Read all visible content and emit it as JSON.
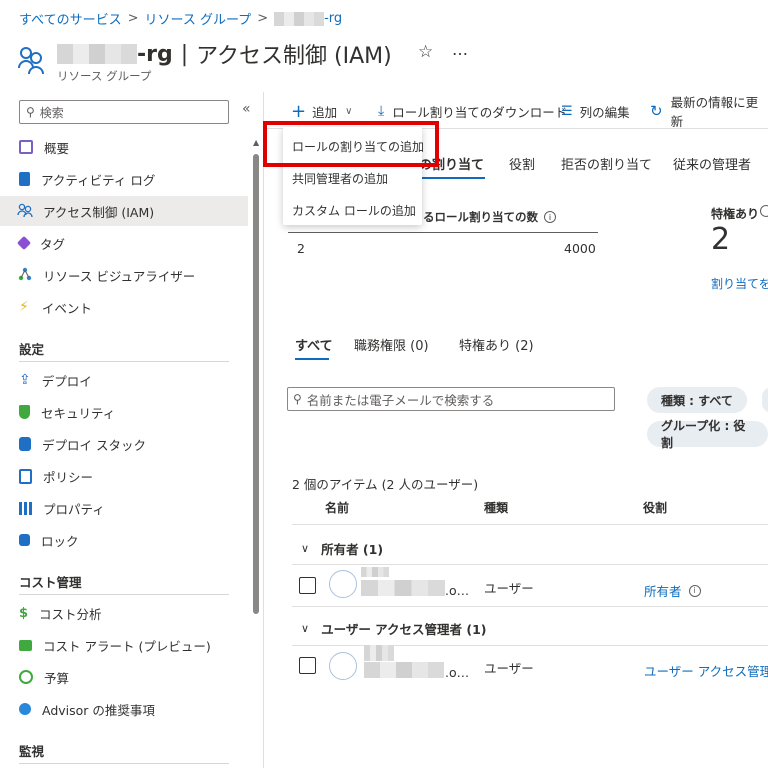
{
  "breadcrumb": {
    "items": [
      "すべてのサービス",
      "リソース グループ"
    ],
    "current_suffix": "-rg",
    "separator": ">"
  },
  "header": {
    "title_suffix": "-rg",
    "title_separator": "|",
    "page_name": "アクセス制御 (IAM)",
    "subtitle": "リソース グループ",
    "star_icon": "star-icon",
    "more_label": "…"
  },
  "sidebar": {
    "search_placeholder": "検索",
    "collapse_label": "«",
    "items": [
      {
        "label": "概要",
        "icon": "overview-icon",
        "color": "#7a5fc4"
      },
      {
        "label": "アクティビティ ログ",
        "icon": "activity-log-icon",
        "color": "#1f6fc4"
      },
      {
        "label": "アクセス制御 (IAM)",
        "icon": "iam-icon",
        "color": "#1f6fc4",
        "active": true
      },
      {
        "label": "タグ",
        "icon": "tag-icon",
        "color": "#8a4fd3"
      },
      {
        "label": "リソース ビジュアライザー",
        "icon": "visualizer-icon",
        "color": "#2b88d8"
      },
      {
        "label": "イベント",
        "icon": "event-icon",
        "color": "#f2b50c"
      }
    ],
    "section_settings": "設定",
    "settings_items": [
      {
        "label": "デプロイ",
        "icon": "deploy-icon",
        "color": "#1f6fc4"
      },
      {
        "label": "セキュリティ",
        "icon": "security-icon",
        "color": "#3fa83f"
      },
      {
        "label": "デプロイ スタック",
        "icon": "deploy-stack-icon",
        "color": "#1f6fc4"
      },
      {
        "label": "ポリシー",
        "icon": "policy-icon",
        "color": "#1f6fc4"
      },
      {
        "label": "プロパティ",
        "icon": "properties-icon",
        "color": "#1f6fc4"
      },
      {
        "label": "ロック",
        "icon": "lock-icon",
        "color": "#1f6fc4"
      }
    ],
    "section_cost": "コスト管理",
    "cost_items": [
      {
        "label": "コスト分析",
        "icon": "cost-analysis-icon",
        "color": "#3fa83f"
      },
      {
        "label": "コスト アラート (プレビュー)",
        "icon": "cost-alert-icon",
        "color": "#3fa83f"
      },
      {
        "label": "予算",
        "icon": "budget-icon",
        "color": "#3fa83f"
      },
      {
        "label": "Advisor の推奨事項",
        "icon": "advisor-icon",
        "color": "#2b88d8"
      }
    ],
    "section_monitor": "監視"
  },
  "toolbar": {
    "add_label": "追加",
    "download_label": "ロール割り当てのダウンロード",
    "edit_columns_label": "列の編集",
    "refresh_label": "最新の情報に更新"
  },
  "dropdown": {
    "items": [
      "ロールの割り当ての追加",
      "共同管理者の追加",
      "カスタム ロールの追加"
    ]
  },
  "tabs": {
    "items": [
      "の割り当て",
      "役割",
      "拒否の割り当て",
      "従来の管理者"
    ],
    "active_index": 0
  },
  "stats": {
    "count_label": "るロール割り当ての数",
    "current": "2",
    "max": "4000",
    "privileged_label": "特権あり",
    "privileged_count": "2",
    "privileged_link": "割り当てを表"
  },
  "filter_tabs": {
    "items": [
      "すべて",
      "職務権限 (0)",
      "特権あり (2)"
    ],
    "active_index": 0
  },
  "search": {
    "placeholder": "名前または電子メールで検索する"
  },
  "chips": {
    "type": "種類 : すべて",
    "group": "グループ化 : 役割"
  },
  "table": {
    "summary": "2 個のアイテム (2 人のユーザー)",
    "columns": [
      "名前",
      "種類",
      "役割"
    ],
    "groups": [
      {
        "label": "所有者 (1)",
        "rows": [
          {
            "email_suffix": ".o…",
            "type": "ユーザー",
            "role": "所有者"
          }
        ]
      },
      {
        "label": "ユーザー アクセス管理者 (1)",
        "rows": [
          {
            "email_suffix": ".o…",
            "type": "ユーザー",
            "role": "ユーザー アクセス管理者"
          }
        ]
      }
    ]
  },
  "colors": {
    "accent": "#0f6cbd",
    "highlight_box": "#e00000",
    "active_nav_bg": "#edebe9"
  }
}
